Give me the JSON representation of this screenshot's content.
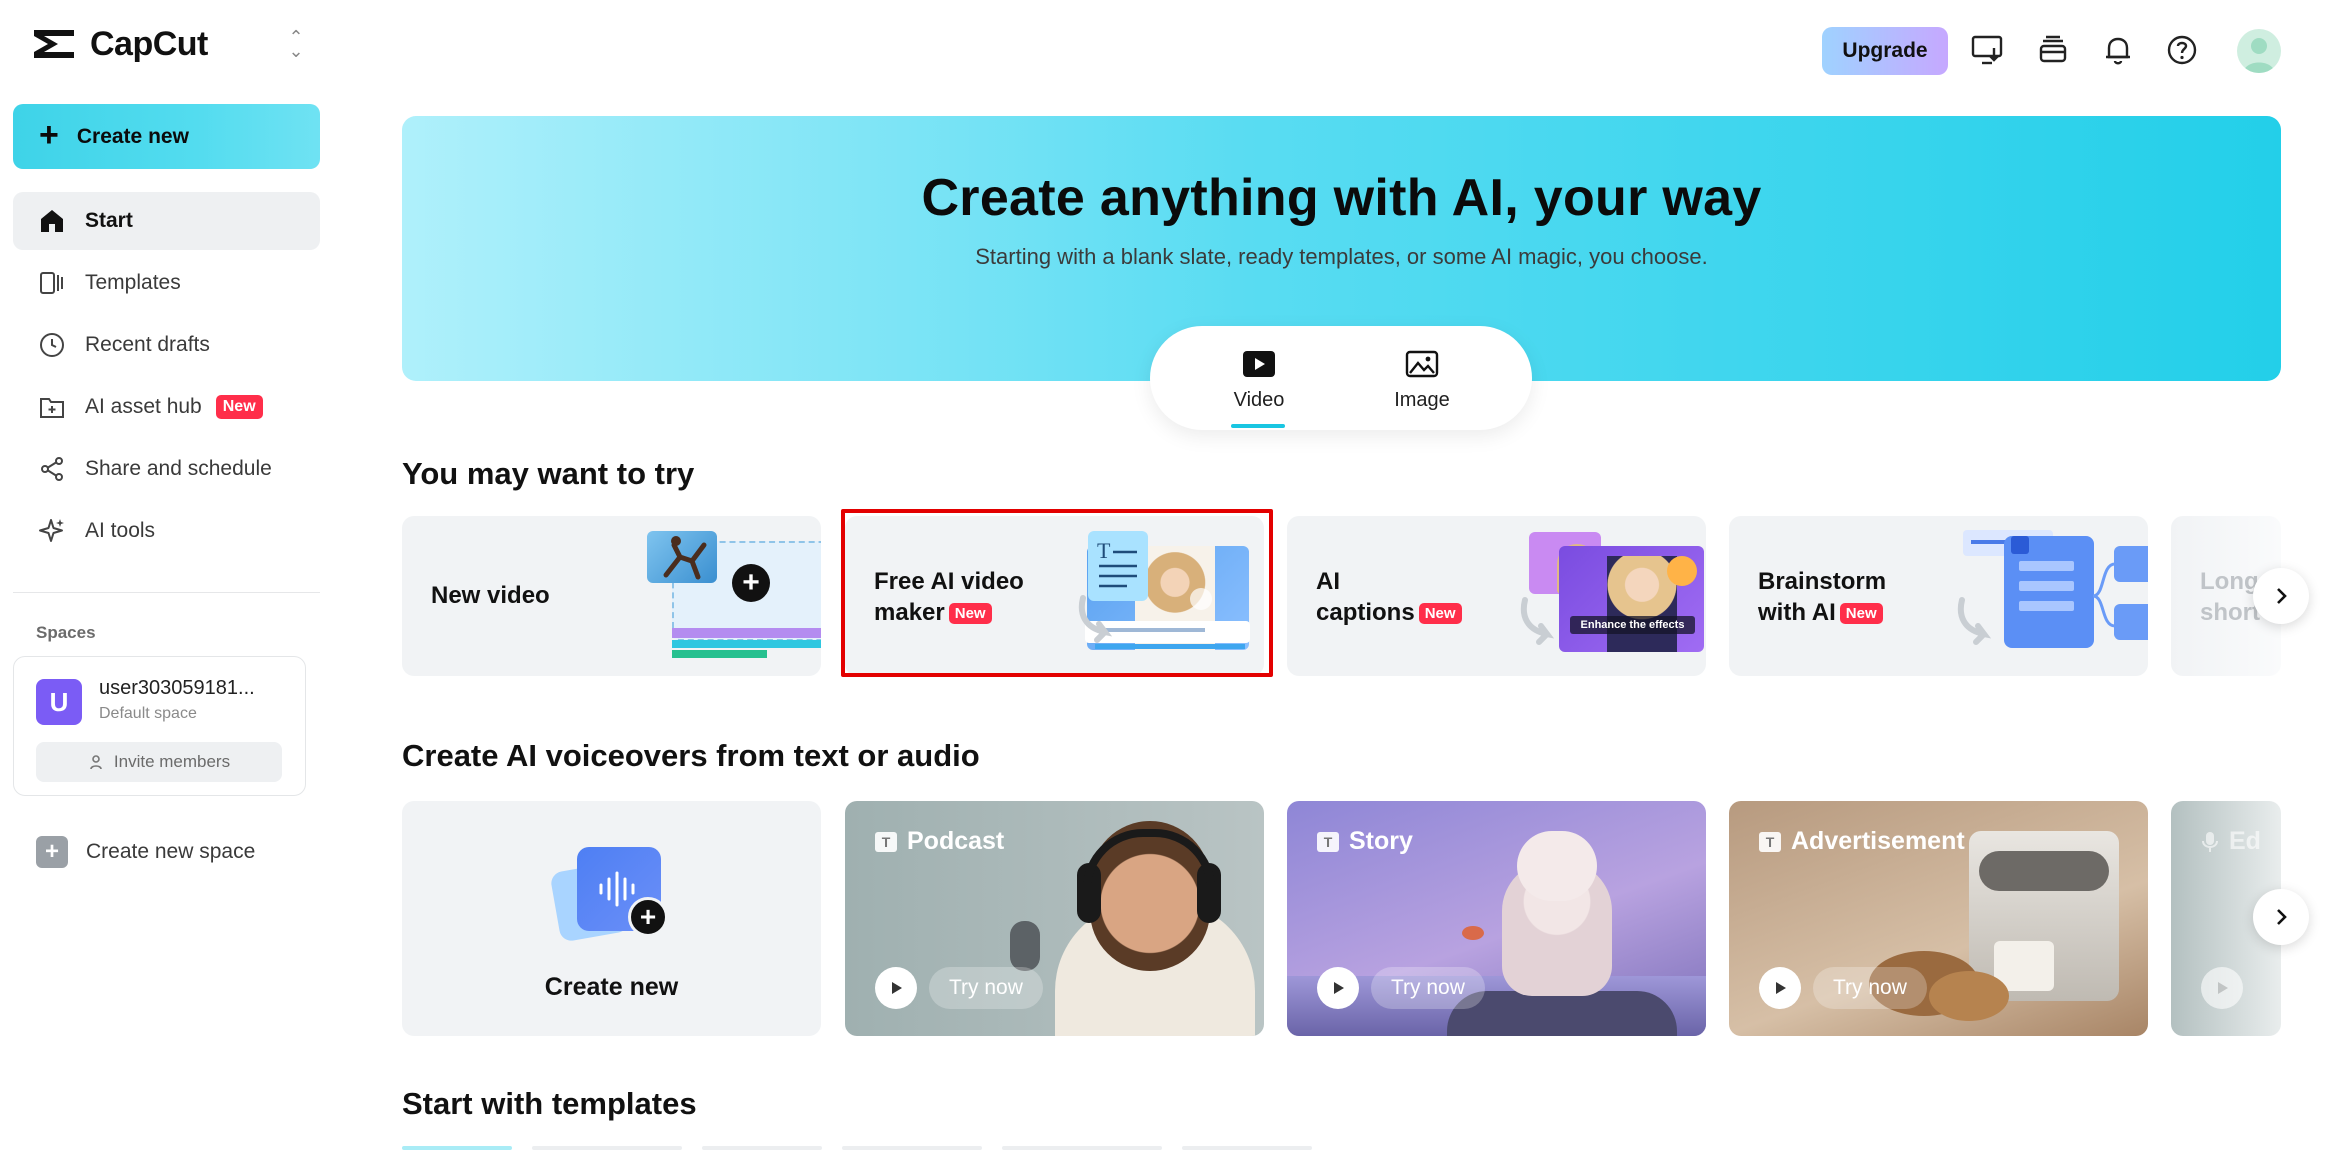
{
  "brand": {
    "name": "CapCut"
  },
  "sidebar": {
    "create_label": "Create new",
    "items": [
      {
        "label": "Start",
        "icon": "home-icon",
        "active": true
      },
      {
        "label": "Templates",
        "icon": "templates-icon"
      },
      {
        "label": "Recent drafts",
        "icon": "clock-icon"
      },
      {
        "label": "AI asset hub",
        "icon": "folder-plus-icon",
        "badge": "New"
      },
      {
        "label": "Share and schedule",
        "icon": "share-icon"
      },
      {
        "label": "AI tools",
        "icon": "sparkle-icon"
      }
    ],
    "spaces_title": "Spaces",
    "space": {
      "initial": "U",
      "user": "user303059181...",
      "sub": "Default space",
      "invite_label": "Invite members"
    },
    "create_space_label": "Create new space"
  },
  "topbar": {
    "upgrade_label": "Upgrade"
  },
  "hero": {
    "title": "Create anything with AI, your way",
    "subtitle": "Starting with a blank slate, ready templates, or some AI magic, you choose.",
    "modes": [
      {
        "label": "Video",
        "active": true
      },
      {
        "label": "Image"
      }
    ]
  },
  "try_section": {
    "title": "You may want to try",
    "cards": [
      {
        "line1": "New video",
        "line2": "",
        "badge": ""
      },
      {
        "line1": "Free AI video",
        "line2": "maker",
        "badge": "New"
      },
      {
        "line1": "AI",
        "line2": "captions",
        "badge": "New"
      },
      {
        "line1": "Brainstorm",
        "line2": "with AI",
        "badge": "New"
      },
      {
        "line1": "Long",
        "line2": "short",
        "badge": ""
      }
    ],
    "captions_overlay": "Enhance the effects"
  },
  "voice_section": {
    "title": "Create AI voiceovers from text or audio",
    "create_label": "Create new",
    "cards": [
      {
        "title": "Podcast",
        "try": "Try now"
      },
      {
        "title": "Story",
        "try": "Try now"
      },
      {
        "title": "Advertisement",
        "try": "Try now"
      },
      {
        "title": "Ed",
        "try": ""
      }
    ]
  },
  "templates_section": {
    "title": "Start with templates"
  },
  "colors": {
    "accent": "#19c6e2",
    "badge": "#ff2e4a",
    "highlight": "#e30000",
    "hero_start": "#aff0fb",
    "hero_end": "#23cfe9"
  }
}
